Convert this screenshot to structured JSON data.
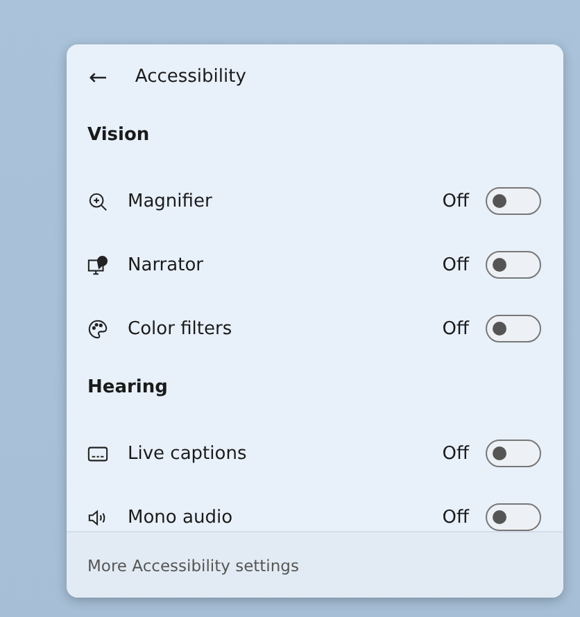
{
  "header": {
    "back": "←",
    "title": "Accessibility"
  },
  "sections": [
    {
      "heading": "Vision",
      "items": [
        {
          "kind": "magnifier",
          "label": "Magnifier",
          "status": "Off",
          "on": false
        },
        {
          "kind": "narrator",
          "label": "Narrator",
          "status": "Off",
          "on": false
        },
        {
          "kind": "palette",
          "label": "Color filters",
          "status": "Off",
          "on": false
        }
      ]
    },
    {
      "heading": "Hearing",
      "items": [
        {
          "kind": "captions",
          "label": "Live captions",
          "status": "Off",
          "on": false
        },
        {
          "kind": "speaker",
          "label": "Mono audio",
          "status": "Off",
          "on": false
        }
      ]
    }
  ],
  "footer": {
    "link": "More Accessibility settings"
  }
}
